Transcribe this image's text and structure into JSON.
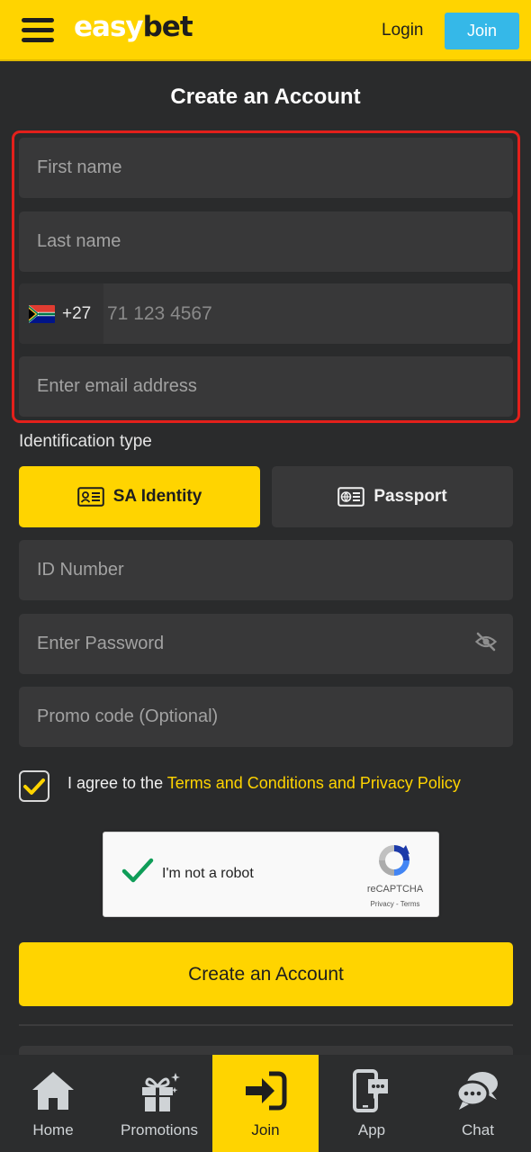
{
  "header": {
    "logo_easy": "easy",
    "logo_bet": "bet",
    "login_label": "Login",
    "join_label": "Join"
  },
  "page_title": "Create an Account",
  "form": {
    "first_name_placeholder": "First name",
    "last_name_placeholder": "Last name",
    "phone": {
      "country_code": "+27",
      "placeholder": "71 123 4567"
    },
    "email_placeholder": "Enter email address",
    "identification_label": "Identification type",
    "id_options": [
      {
        "label": "SA Identity",
        "selected": true
      },
      {
        "label": "Passport",
        "selected": false
      }
    ],
    "id_number_placeholder": "ID Number",
    "password_placeholder": "Enter Password",
    "promo_placeholder": "Promo code (Optional)",
    "agree_prefix": "I agree to the ",
    "agree_link": "Terms and Conditions and Privacy Policy",
    "agree_checked": true,
    "submit_label": "Create an Account"
  },
  "recaptcha": {
    "label": "I'm not a robot",
    "brand": "reCAPTCHA",
    "terms": "Privacy - Terms",
    "checked": true
  },
  "bottom_nav": [
    {
      "label": "Home",
      "icon": "home-icon",
      "active": false
    },
    {
      "label": "Promotions",
      "icon": "gift-icon",
      "active": false
    },
    {
      "label": "Join",
      "icon": "sign-in-icon",
      "active": true
    },
    {
      "label": "App",
      "icon": "mobile-app-icon",
      "active": false
    },
    {
      "label": "Chat",
      "icon": "chat-icon",
      "active": false
    }
  ],
  "colors": {
    "brand_yellow": "#ffd400",
    "join_blue": "#35b8e8",
    "background": "#2a2b2c",
    "field": "#383839",
    "highlight_red": "#e3201b"
  }
}
